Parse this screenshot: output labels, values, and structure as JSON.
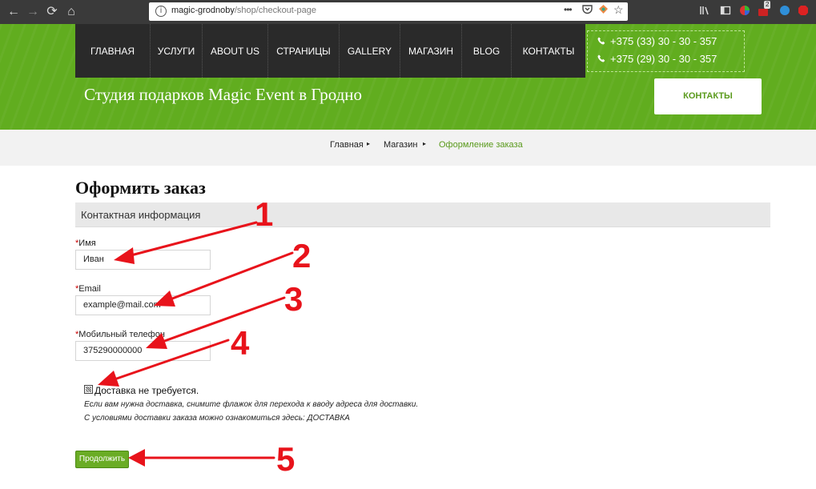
{
  "browser": {
    "back": "←",
    "forward": "→",
    "reload": "⟳",
    "home": "⌂",
    "url_host": "magic-grodnoby",
    "url_path": "/shop/checkout-page",
    "menu_dots": "•••",
    "badge_count": "2"
  },
  "nav": {
    "items": [
      "ГЛАВНАЯ",
      "УСЛУГИ",
      "ABOUT US",
      "СТРАНИЦЫ",
      "GALLERY",
      "МАГАЗИН",
      "BLOG",
      "КОНТАКТЫ"
    ]
  },
  "phones": [
    "+375 (33) 30 - 30 - 357",
    "+375 (29) 30 - 30 - 357"
  ],
  "header": {
    "title": "Студия подарков Magic Event в Гродно",
    "contact_button": "КОНТАКТЫ"
  },
  "breadcrumb": [
    "Главная",
    "Магазин",
    "Оформление заказа"
  ],
  "form": {
    "title": "Оформить заказ",
    "section": "Контактная информация",
    "name_label": "Имя",
    "name_value": "Иван",
    "email_label": "Email",
    "email_value": "example@mail.com",
    "phone_label": "Мобильный телефон",
    "phone_value": "375290000000",
    "required_mark": "*",
    "delivery_checkbox": "Доставка не требуется.",
    "hint1": "Если вам нужна доставка, снимите флажок для перехода к вводу адреса для доставки.",
    "hint2": "С условиями доставки заказа можно ознакомиться здесь: ДОСТАВКА",
    "submit": "Продолжить"
  },
  "annotations": [
    "1",
    "2",
    "3",
    "4",
    "5"
  ],
  "colors": {
    "accent": "#61ad1f",
    "menu_bg": "#2a2a2a",
    "annotation": "#e8131b"
  }
}
